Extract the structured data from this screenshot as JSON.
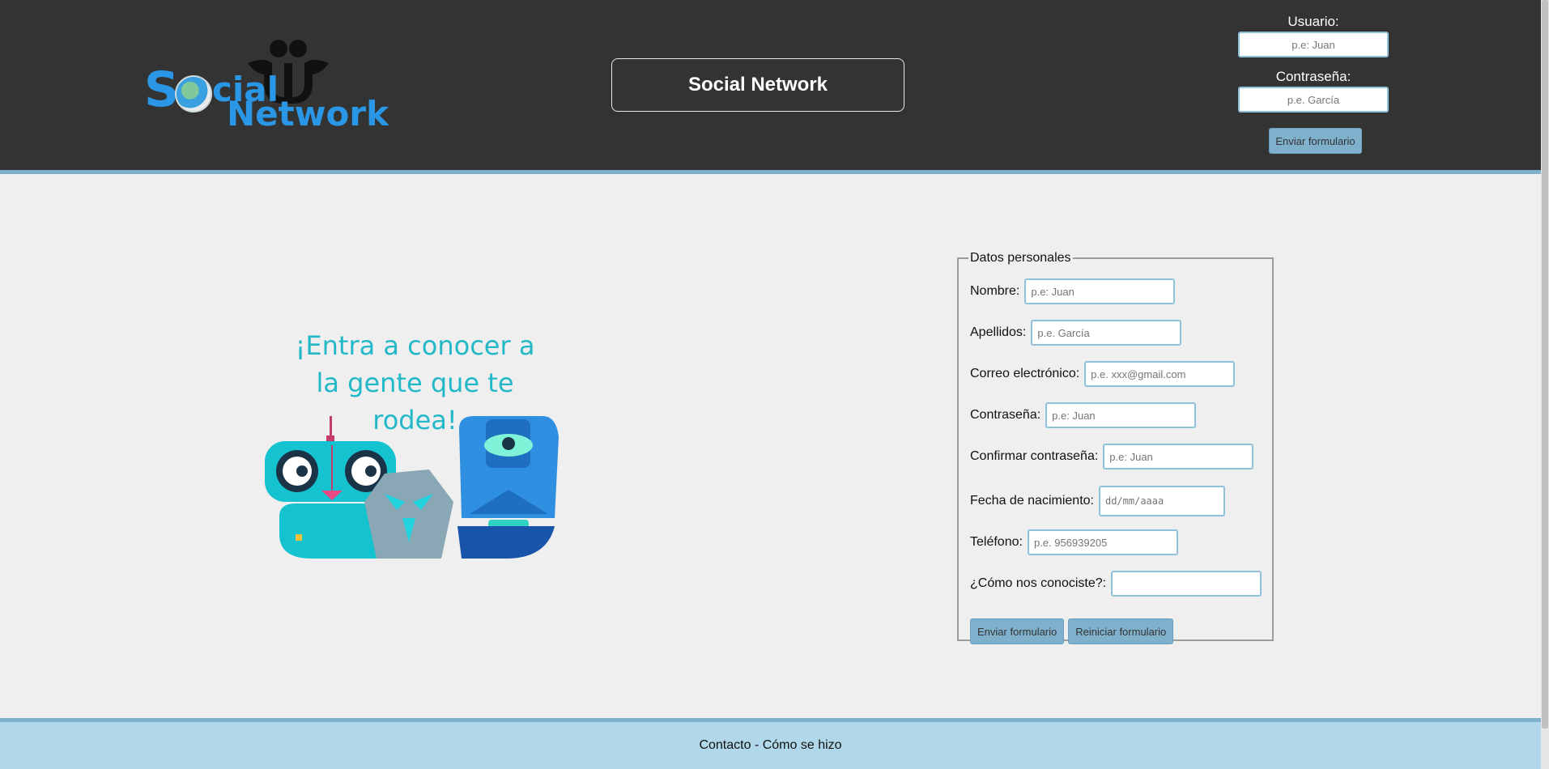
{
  "header": {
    "logo": {
      "text_s": "S",
      "text_cial": "cial",
      "text_network": "Network"
    },
    "title": "Social Network",
    "login": {
      "user_label": "Usuario:",
      "user_placeholder": "p.e: Juan",
      "password_label": "Contraseña:",
      "password_placeholder": "p.e. García",
      "submit_label": "Enviar formulario"
    }
  },
  "hero": {
    "line1": "¡Entra a conocer a",
    "line2": "la gente que te rodea!"
  },
  "form": {
    "legend": "Datos personales",
    "fields": [
      {
        "label": "Nombre:",
        "placeholder": "p.e: Juan"
      },
      {
        "label": "Apellidos:",
        "placeholder": "p.e. García"
      },
      {
        "label": "Correo electrónico:",
        "placeholder": "p.e. xxx@gmail.com"
      },
      {
        "label": "Contraseña:",
        "placeholder": "p.e: Juan"
      },
      {
        "label": "Confirmar contraseña:",
        "placeholder": "p.e: Juan"
      },
      {
        "label": "Fecha de nacimiento:",
        "placeholder": "dd/mm/aaaa"
      },
      {
        "label": "Teléfono:",
        "placeholder": "p.e. 956939205"
      },
      {
        "label": "¿Cómo nos conociste?:",
        "placeholder": ""
      }
    ],
    "submit_label": "Enviar formulario",
    "reset_label": "Reiniciar formulario"
  },
  "footer": {
    "contact": "Contacto",
    "separator": " - ",
    "how_made": "Cómo se hizo"
  },
  "colors": {
    "header_bg": "#333333",
    "accent": "#7fb1cd",
    "footer_bg": "#b0d8ea",
    "hero_text": "#23b8c8",
    "logo_blue": "#2a97e6"
  }
}
